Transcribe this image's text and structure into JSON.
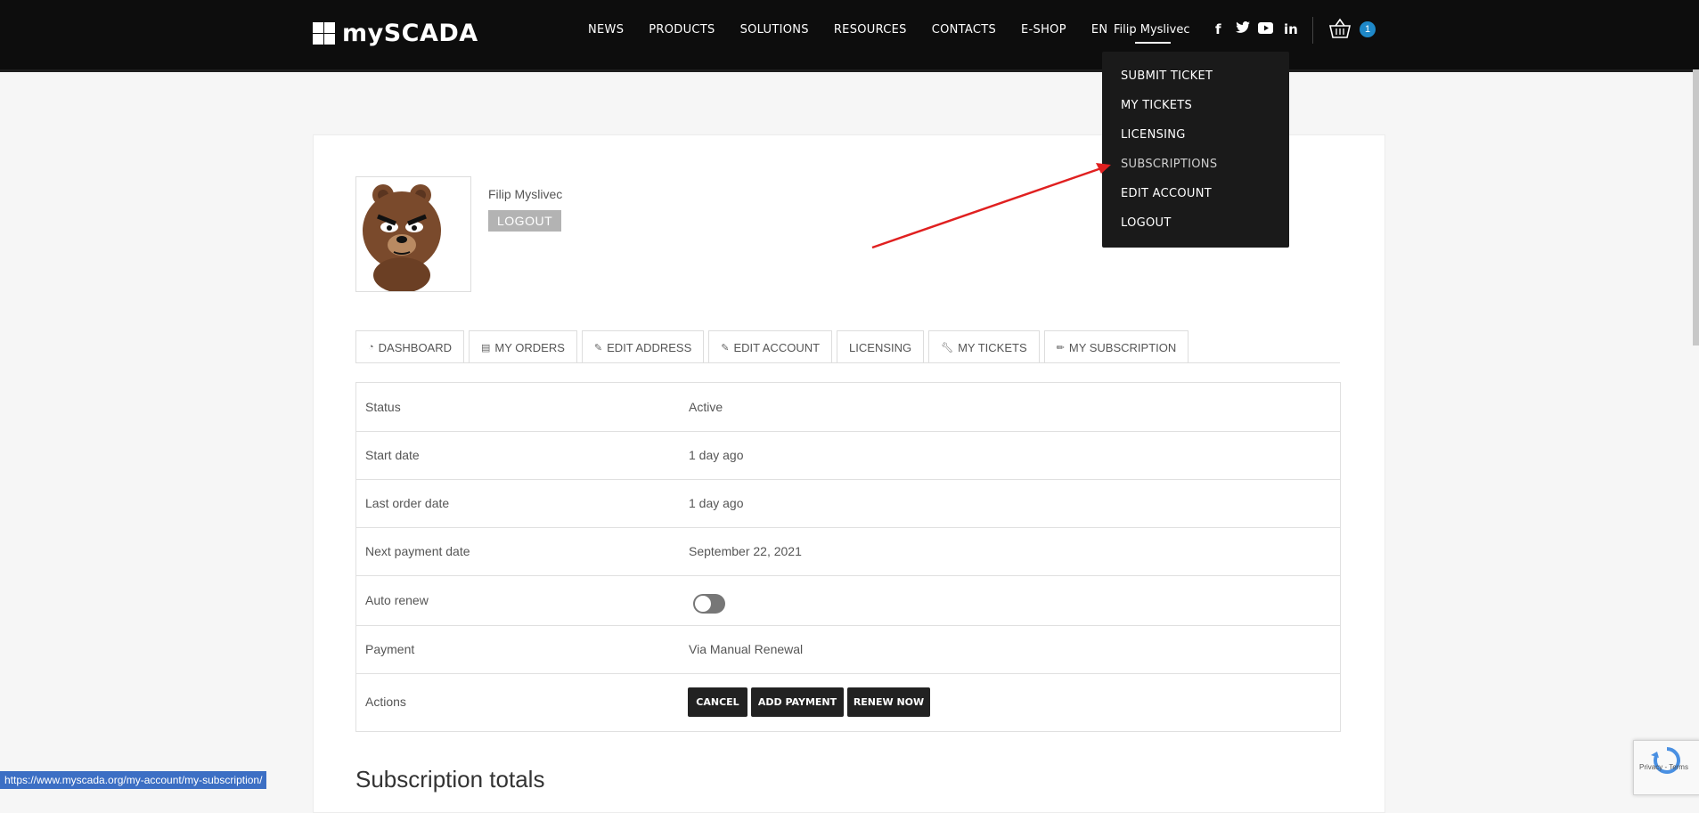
{
  "header": {
    "logo_text": "mySCADA",
    "nav": [
      "NEWS",
      "PRODUCTS",
      "SOLUTIONS",
      "RESOURCES",
      "CONTACTS",
      "E-SHOP",
      "EN"
    ],
    "user_name": "Filip Myslivec",
    "social": {
      "facebook": "f",
      "twitter": "🐦",
      "youtube": "▶",
      "linkedin": "in"
    },
    "cart_count": "1"
  },
  "dropdown": {
    "items": [
      "SUBMIT TICKET",
      "MY TICKETS",
      "LICENSING",
      "SUBSCRIPTIONS",
      "EDIT ACCOUNT",
      "LOGOUT"
    ]
  },
  "profile": {
    "name": "Filip Myslivec",
    "logout_label": "LOGOUT"
  },
  "tabs": [
    {
      "label": "DASHBOARD",
      "icon": "dashboard-icon"
    },
    {
      "label": "MY ORDERS",
      "icon": "document-icon"
    },
    {
      "label": "EDIT ADDRESS",
      "icon": "edit-icon"
    },
    {
      "label": "EDIT ACCOUNT",
      "icon": "edit-icon"
    },
    {
      "label": "LICENSING",
      "icon": ""
    },
    {
      "label": "MY TICKETS",
      "icon": "wrench-icon"
    },
    {
      "label": "MY SUBSCRIPTION",
      "icon": "pencil-icon"
    }
  ],
  "subscription": {
    "rows": [
      {
        "key": "Status",
        "value": "Active"
      },
      {
        "key": "Start date",
        "value": "1 day ago"
      },
      {
        "key": "Last order date",
        "value": "1 day ago"
      },
      {
        "key": "Next payment date",
        "value": "September 22, 2021"
      },
      {
        "key": "Auto renew",
        "value": ""
      },
      {
        "key": "Payment",
        "value": "Via Manual Renewal"
      },
      {
        "key": "Actions",
        "value": ""
      }
    ],
    "auto_renew_on": false,
    "actions": [
      "CANCEL",
      "ADD PAYMENT",
      "RENEW NOW"
    ]
  },
  "totals_heading": "Subscription totals",
  "status_url": "https://www.myscada.org/my-account/my-subscription/",
  "recaptcha_links": "Privacy - Terms",
  "colors": {
    "header_bg": "#0d0d0d",
    "accent_badge": "#1e88c8",
    "arrow": "#e02020"
  }
}
